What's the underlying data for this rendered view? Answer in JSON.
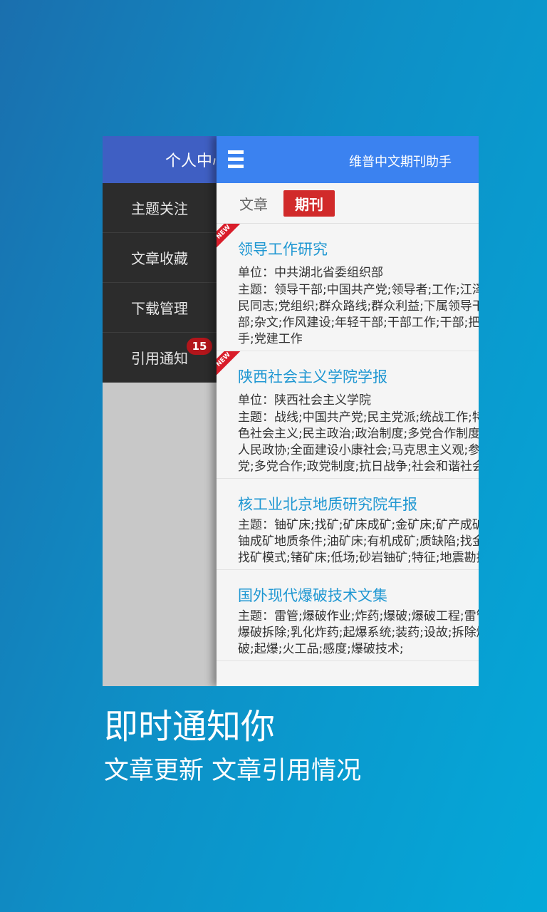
{
  "drawer": {
    "header_title": "个人中心",
    "items": [
      {
        "label": "主题关注"
      },
      {
        "label": "文章收藏"
      },
      {
        "label": "下载管理"
      },
      {
        "label": "引用通知",
        "badge": "15"
      }
    ]
  },
  "appbar": {
    "title": "维普中文期刊助手"
  },
  "tabs": [
    {
      "label": "文章",
      "active": false
    },
    {
      "label": "期刊",
      "active": true
    }
  ],
  "items": [
    {
      "new": true,
      "title": "领导工作研究",
      "unit": "单位：中共湖北省委组织部",
      "topics": "主题：领导干部;中国共产党;领导者;工作;江泽民同志;党组织;群众路线;群众利益;下属领导干部;杂文;作风建设;年轻干部;干部工作;干部;把手;党建工作"
    },
    {
      "new": true,
      "title": "陕西社会主义学院学报",
      "unit": "单位：陕西社会主义学院",
      "topics": "主题：战线;中国共产党;民主党派;统战工作;特色社会主义;民主政治;政治制度;多党合作制度;人民政协;全面建设小康社会;马克思主义观;参政党;多党合作;政党制度;抗日战争;社会和谐社会"
    },
    {
      "new": false,
      "title": "核工业北京地质研究院年报",
      "unit": "",
      "topics": "主题：铀矿床;找矿;矿床成矿;金矿床;矿产成矿;铀成矿地质条件;油矿床;有机成矿;质缺陷;找金;找矿模式;锗矿床;低场;砂岩铀矿;特征;地震勘探"
    },
    {
      "new": false,
      "title": "国外现代爆破技术文集",
      "unit": "",
      "topics": "主题：雷管;爆破作业;炸药;爆破;爆破工程;雷管;爆破拆除;乳化炸药;起爆系统;装药;设故;拆除爆破;起爆;火工品;感度;爆破技术;"
    }
  ],
  "ribbon_text": "NEW",
  "caption": {
    "headline": "即时通知你",
    "subline": "文章更新  文章引用情况"
  }
}
